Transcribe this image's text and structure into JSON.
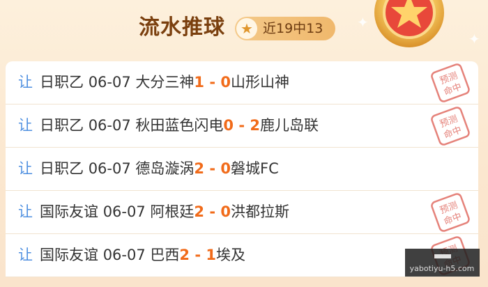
{
  "header": {
    "title": "流水推球",
    "badge_text": "近19中13",
    "star_icon": "star-icon",
    "medal_icon": "star-medal-icon"
  },
  "stamp": {
    "line1": "预测",
    "line2": "命中"
  },
  "colors": {
    "accent": "#f16b1a",
    "rang": "#4e8fe0",
    "title": "#7a3f0e",
    "stamp": "#e5827a"
  },
  "matches": [
    {
      "rang": "让",
      "league": "日职乙",
      "date": "06-07",
      "home": "大分三神",
      "home_score": "1",
      "sep": " - ",
      "away_score": "0",
      "away": "山形山神",
      "hit": true
    },
    {
      "rang": "让",
      "league": "日职乙",
      "date": "06-07",
      "home": "秋田蓝色闪电",
      "home_score": "0",
      "sep": " - ",
      "away_score": "2",
      "away": "鹿儿岛联",
      "hit": true
    },
    {
      "rang": "让",
      "league": "日职乙",
      "date": "06-07",
      "home": "德岛漩涡",
      "home_score": "2",
      "sep": " - ",
      "away_score": "0",
      "away": "磐城FC",
      "hit": false
    },
    {
      "rang": "让",
      "league": "国际友谊",
      "date": "06-07",
      "home": "阿根廷",
      "home_score": "2",
      "sep": " - ",
      "away_score": "0",
      "away": "洪都拉斯",
      "hit": true
    },
    {
      "rang": "让",
      "league": "国际友谊",
      "date": "06-07",
      "home": "巴西",
      "home_score": "2",
      "sep": " - ",
      "away_score": "1",
      "away": "埃及",
      "hit": true
    }
  ],
  "watermark": {
    "text": "yabotiyu-h5.com"
  }
}
